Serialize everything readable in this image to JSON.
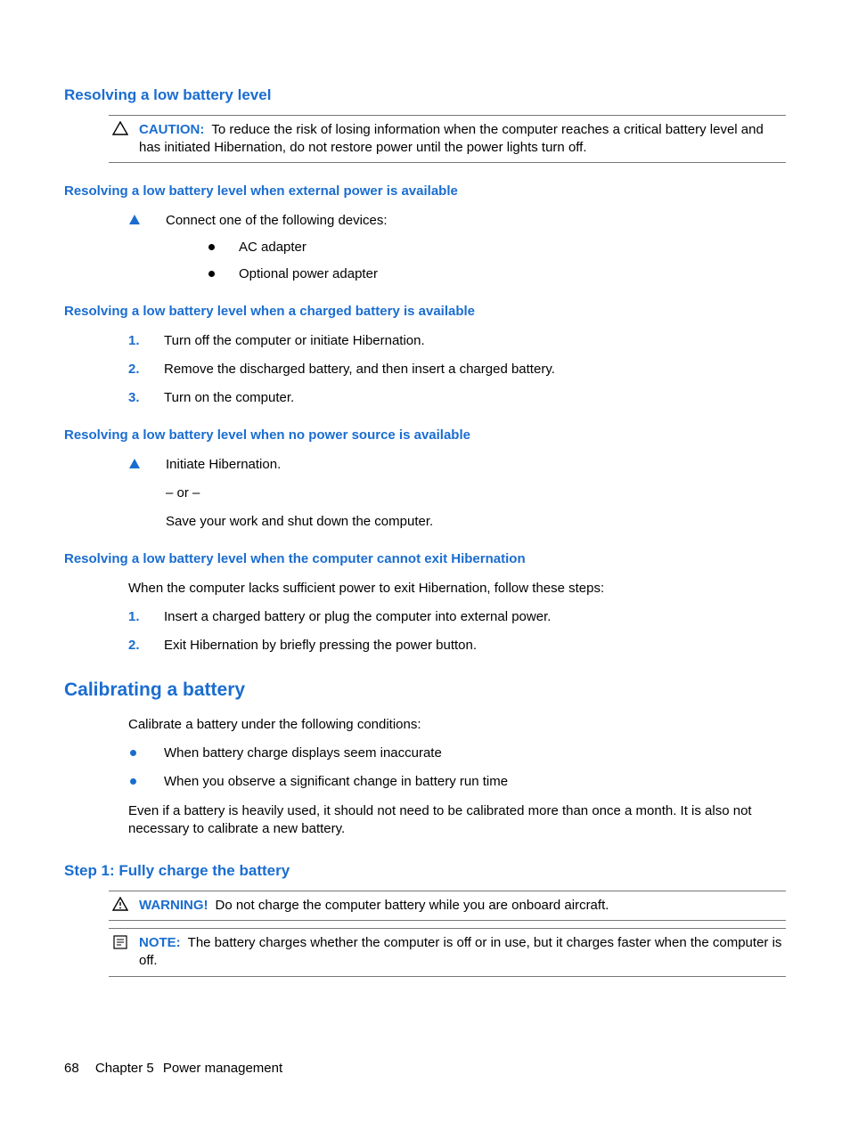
{
  "section1": {
    "title": "Resolving a low battery level",
    "caution": {
      "label": "CAUTION:",
      "text": "To reduce the risk of losing information when the computer reaches a critical battery level and has initiated Hibernation, do not restore power until the power lights turn off."
    },
    "sub1": {
      "title": "Resolving a low battery level when external power is available",
      "lead": "Connect one of the following devices:",
      "bullets": [
        "AC adapter",
        "Optional power adapter"
      ]
    },
    "sub2": {
      "title": "Resolving a low battery level when a charged battery is available",
      "steps": [
        "Turn off the computer or initiate Hibernation.",
        "Remove the discharged battery, and then insert a charged battery.",
        "Turn on the computer."
      ]
    },
    "sub3": {
      "title": "Resolving a low battery level when no power source is available",
      "line1": "Initiate Hibernation.",
      "or": "– or –",
      "line2": "Save your work and shut down the computer."
    },
    "sub4": {
      "title": "Resolving a low battery level when the computer cannot exit Hibernation",
      "intro": "When the computer lacks sufficient power to exit Hibernation, follow these steps:",
      "steps": [
        "Insert a charged battery or plug the computer into external power.",
        "Exit Hibernation by briefly pressing the power button."
      ]
    }
  },
  "section2": {
    "title": "Calibrating a battery",
    "intro": "Calibrate a battery under the following conditions:",
    "bullets": [
      "When battery charge displays seem inaccurate",
      "When you observe a significant change in battery run time"
    ],
    "after": "Even if a battery is heavily used, it should not need to be calibrated more than once a month. It is also not necessary to calibrate a new battery.",
    "step1": {
      "title": "Step 1: Fully charge the battery",
      "warning": {
        "label": "WARNING!",
        "text": "Do not charge the computer battery while you are onboard aircraft."
      },
      "note": {
        "label": "NOTE:",
        "text": "The battery charges whether the computer is off or in use, but it charges faster when the computer is off."
      }
    }
  },
  "footer": {
    "page": "68",
    "chapter": "Chapter 5",
    "title": "Power management"
  }
}
